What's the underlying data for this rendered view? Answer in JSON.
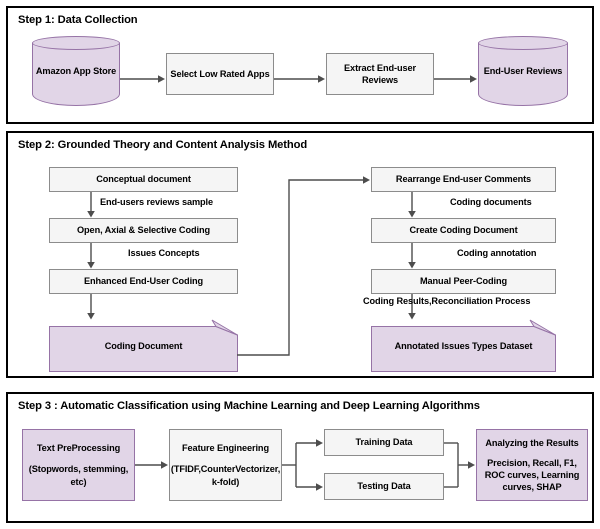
{
  "figure": {
    "title": "Research methodology flowchart",
    "colors": {
      "panel_border": "#000000",
      "process_fill": "#f5f5f5",
      "process_border": "#8c8c8c",
      "highlight_fill": "#e1d5e7",
      "highlight_border": "#9673a6",
      "connector": "#4d4d4d",
      "background": "#ffffff"
    }
  },
  "step1": {
    "title": "Step 1: Data Collection",
    "nodes": {
      "amazon_app_store": "Amazon App Store",
      "select_low_rated_apps": "Select Low Rated Apps",
      "extract_end_user_reviews": "Extract End-user Reviews",
      "end_user_reviews_db": "End- User Reviews"
    }
  },
  "step2": {
    "title": "Step 2: Grounded Theory and Content Analysis Method",
    "left": {
      "conceptual_document": "Conceptual document",
      "open_axial_selective_coding": "Open, Axial & Selective Coding",
      "enhanced_end_user_coding": "Enhanced End-User Coding",
      "coding_document": "Coding Document"
    },
    "right": {
      "rearrange_end_user_comments": "Rearrange End-user Comments",
      "create_coding_document": "Create Coding Document",
      "manual_peer_coding": "Manual Peer-Coding",
      "annotated_issues_types_dataset": "Annotated Issues Types Dataset"
    },
    "edge_labels": {
      "end_users_reviews_sample": "End-users reviews sample",
      "issues_concepts": "Issues Concepts",
      "coding_documents": "Coding documents",
      "coding_annotation": "Coding annotation",
      "coding_results_reconciliation": "Coding Results,Reconciliation Process"
    }
  },
  "step3": {
    "title": "Step 3 : Automatic Classification using Machine Learning and Deep Learning Algorithms",
    "nodes": {
      "text_preprocessing_title": "Text PreProcessing",
      "text_preprocessing_detail": "(Stopwords, stemming, etc)",
      "feature_engineering_title": "Feature Engineering",
      "feature_engineering_detail": "(TFIDF,CounterVectorizer, k-fold)",
      "training_data": "Training Data",
      "testing_data": "Testing Data",
      "analyzing_results_title": "Analyzing the Results",
      "analyzing_results_detail": "Precision, Recall, F1, ROC curves, Learning curves, SHAP"
    }
  }
}
